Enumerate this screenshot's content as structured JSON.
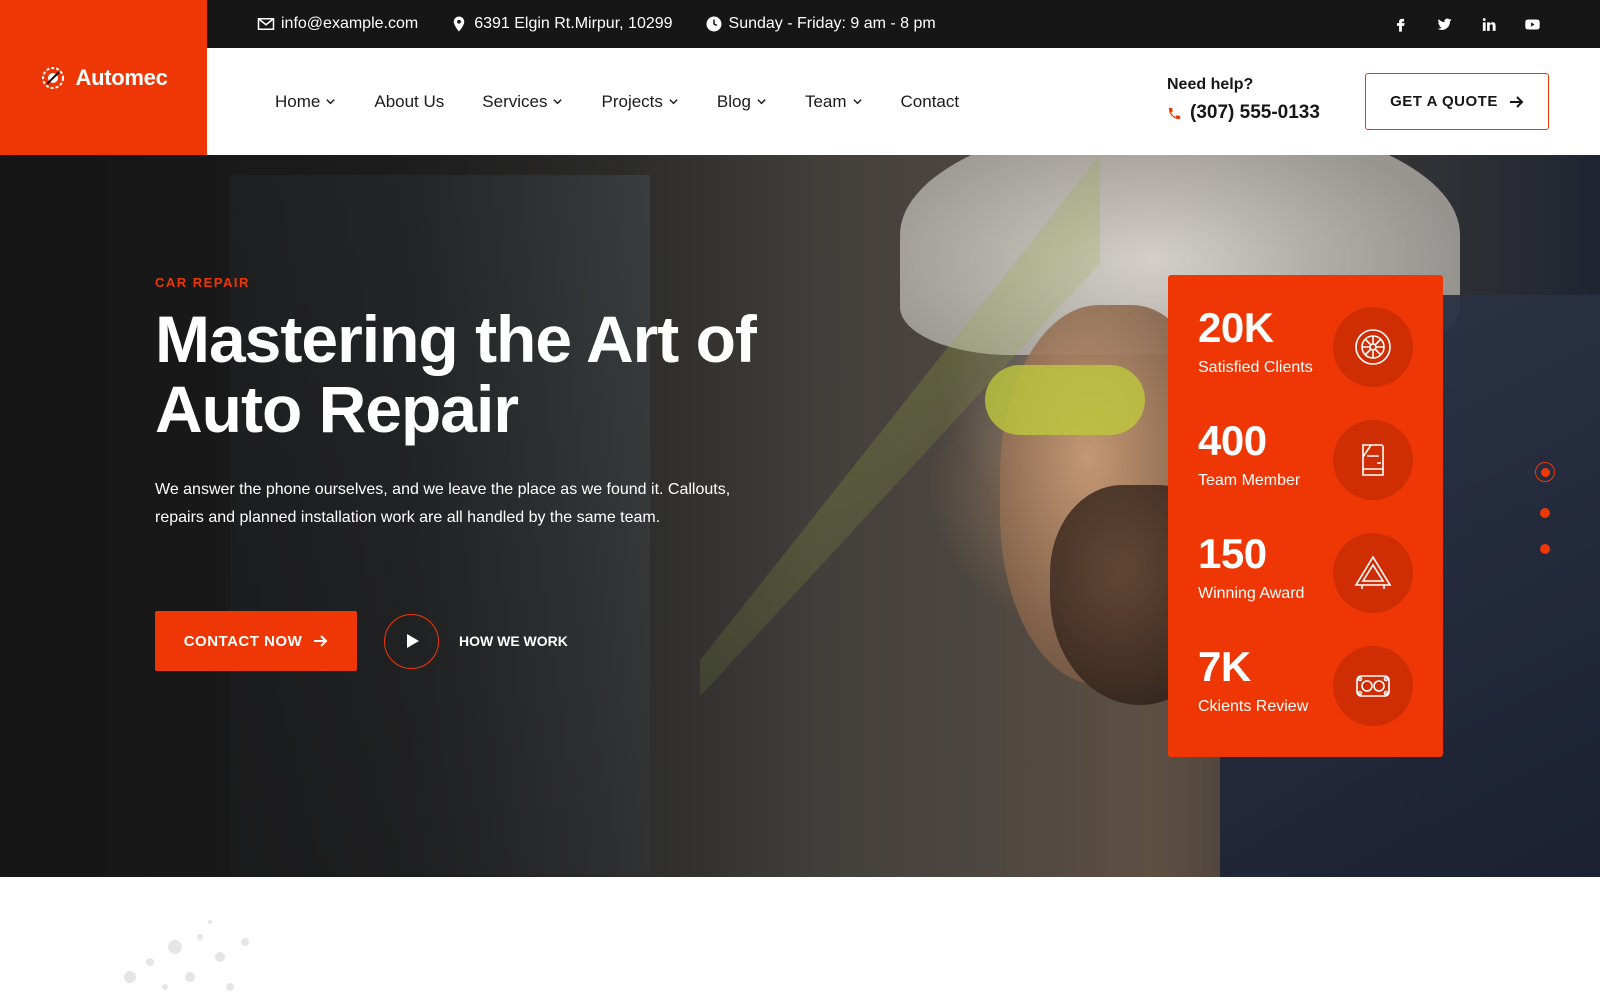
{
  "brand": {
    "name": "Automec",
    "accent": "#ee3705",
    "dark": "#161616"
  },
  "topbar": {
    "email": "info@example.com",
    "address": "6391 Elgin Rt.Mirpur, 10299",
    "hours": "Sunday - Friday: 9 am - 8 pm",
    "socials": [
      "facebook-icon",
      "twitter-icon",
      "linkedin-icon",
      "youtube-icon"
    ]
  },
  "nav": {
    "items": [
      {
        "label": "Home",
        "dropdown": true
      },
      {
        "label": "About Us",
        "dropdown": false
      },
      {
        "label": "Services",
        "dropdown": true
      },
      {
        "label": "Projects",
        "dropdown": true
      },
      {
        "label": "Blog",
        "dropdown": true
      },
      {
        "label": "Team",
        "dropdown": true
      },
      {
        "label": "Contact",
        "dropdown": false
      }
    ],
    "help_label": "Need help?",
    "phone": "(307) 555-0133",
    "quote_label": "GET A QUOTE"
  },
  "hero": {
    "subtitle": "CAR REPAIR",
    "title_line1": "Mastering the Art of",
    "title_line2": "Auto Repair",
    "description": "We answer the phone ourselves, and we leave the place as we found it. Callouts, repairs and planned installation work are all handled by the same team.",
    "contact_label": "CONTACT NOW",
    "how_label": "HOW WE WORK"
  },
  "stats": [
    {
      "value": "20K",
      "label": "Satisfied Clients",
      "icon": "wheel-icon"
    },
    {
      "value": "400",
      "label": "Team Member",
      "icon": "car-door-icon"
    },
    {
      "value": "150",
      "label": "Winning Award",
      "icon": "warning-triangle-icon"
    },
    {
      "value": "7K",
      "label": "Ckients Review",
      "icon": "engine-gasket-icon"
    }
  ],
  "slider": {
    "count": 3,
    "active": 1
  }
}
